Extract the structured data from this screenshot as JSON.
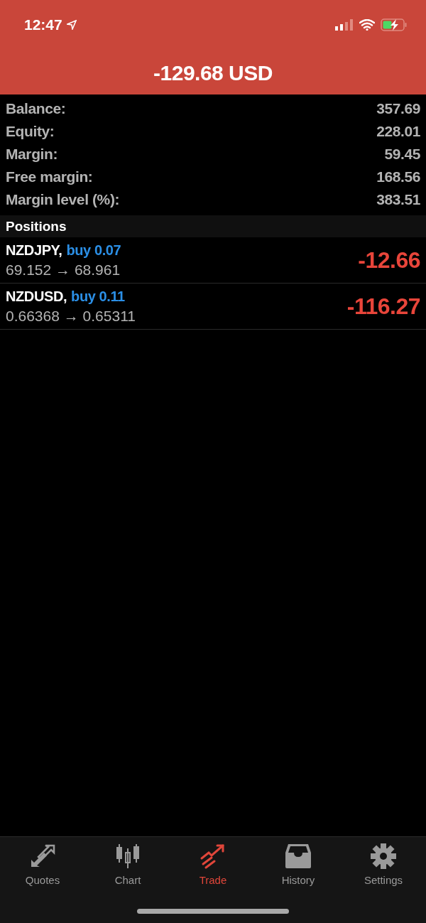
{
  "status_bar": {
    "time": "12:47"
  },
  "header": {
    "title": "-129.68 USD"
  },
  "summary": [
    {
      "label": "Balance:",
      "value": "357.69"
    },
    {
      "label": "Equity:",
      "value": "228.01"
    },
    {
      "label": "Margin:",
      "value": "59.45"
    },
    {
      "label": "Free margin:",
      "value": "168.56"
    },
    {
      "label": "Margin level (%):",
      "value": "383.51"
    }
  ],
  "positions": {
    "title": "Positions",
    "items": [
      {
        "symbol": "NZDJPY,",
        "order": "buy 0.07",
        "prices": "69.152 → 68.961",
        "profit": "-12.66"
      },
      {
        "symbol": "NZDUSD,",
        "order": "buy 0.11",
        "prices": "0.66368 → 0.65311",
        "profit": "-116.27"
      }
    ]
  },
  "tabs": [
    {
      "kind": "quotes",
      "label": "Quotes",
      "selected": false
    },
    {
      "kind": "chart",
      "label": "Chart",
      "selected": false
    },
    {
      "kind": "trade",
      "label": "Trade",
      "selected": true
    },
    {
      "kind": "history",
      "label": "History",
      "selected": false
    },
    {
      "kind": "settings",
      "label": "Settings",
      "selected": false
    }
  ]
}
